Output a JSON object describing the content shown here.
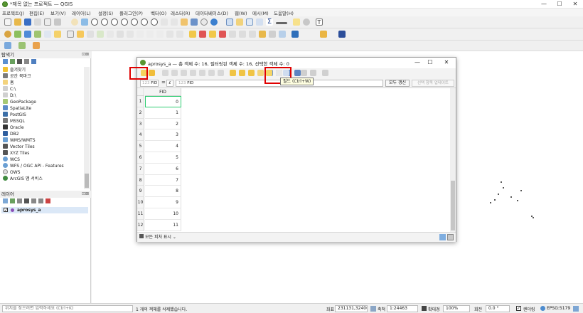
{
  "window": {
    "title": "*제목 없는 프로젝트 — QGIS",
    "min": "—",
    "max": "☐",
    "close": "✕"
  },
  "menus": [
    "프로젝트(J)",
    "편집(E)",
    "보기(V)",
    "레이어(L)",
    "설정(S)",
    "플러그인(P)",
    "벡터(O)",
    "래스터(R)",
    "데이터베이스(D)",
    "웹(W)",
    "메시(M)",
    "도움말(H)"
  ],
  "browser": {
    "title": "탐색기",
    "items": [
      "즐겨찾기",
      "공간 북마크",
      "홈",
      "C:\\",
      "D:\\",
      "GeoPackage",
      "SpatiaLite",
      "PostGIS",
      "MSSQL",
      "Oracle",
      "DB2",
      "WMS/WMTS",
      "Vector Tiles",
      "XYZ Tiles",
      "WCS",
      "WFS / OGC API - Features",
      "OWS",
      "ArcGIS 맵 서비스"
    ]
  },
  "layers": {
    "title": "레이어",
    "layer_name": "aprosys_a"
  },
  "dialog": {
    "title": "aprosys_a — 총 객체 수: 16, 필터링된 객체 수: 16, 선택한 객체 수: 0",
    "field_select": "FID",
    "field_prefix": "123",
    "equals": "=",
    "expression": "FID",
    "update_all": "모두 갱신",
    "update_selected": "선택 항목 업데이트",
    "column_header": "FID",
    "rows": [
      [
        "1",
        "0"
      ],
      [
        "2",
        "1"
      ],
      [
        "3",
        "2"
      ],
      [
        "4",
        "3"
      ],
      [
        "5",
        "4"
      ],
      [
        "6",
        "5"
      ],
      [
        "7",
        "6"
      ],
      [
        "8",
        "7"
      ],
      [
        "9",
        "8"
      ],
      [
        "10",
        "9"
      ],
      [
        "11",
        "10"
      ],
      [
        "12",
        "11"
      ]
    ],
    "show_all": "모든 피처 표시",
    "tooltip": "필드 (Ctrl+W)"
  },
  "status": {
    "locator_placeholder": "위치를 찾으려면 입력하세요 (Ctrl+K)",
    "message": "1 개의 객체를 삭제했습니다.",
    "coord_label": "좌표",
    "coord_value": "231131,324002",
    "scale_label": "축척",
    "scale_value": "1:24463",
    "magnifier_label": "확대경",
    "magnifier_value": "100%",
    "rotation_label": "회전",
    "rotation_value": "0.0 °",
    "render_label": "렌더링",
    "crs": "EPSG:5179"
  },
  "colors": {
    "qgis_green": "#589632",
    "highlight_red": "#e00000",
    "selected_cell": "#2ecc71"
  }
}
